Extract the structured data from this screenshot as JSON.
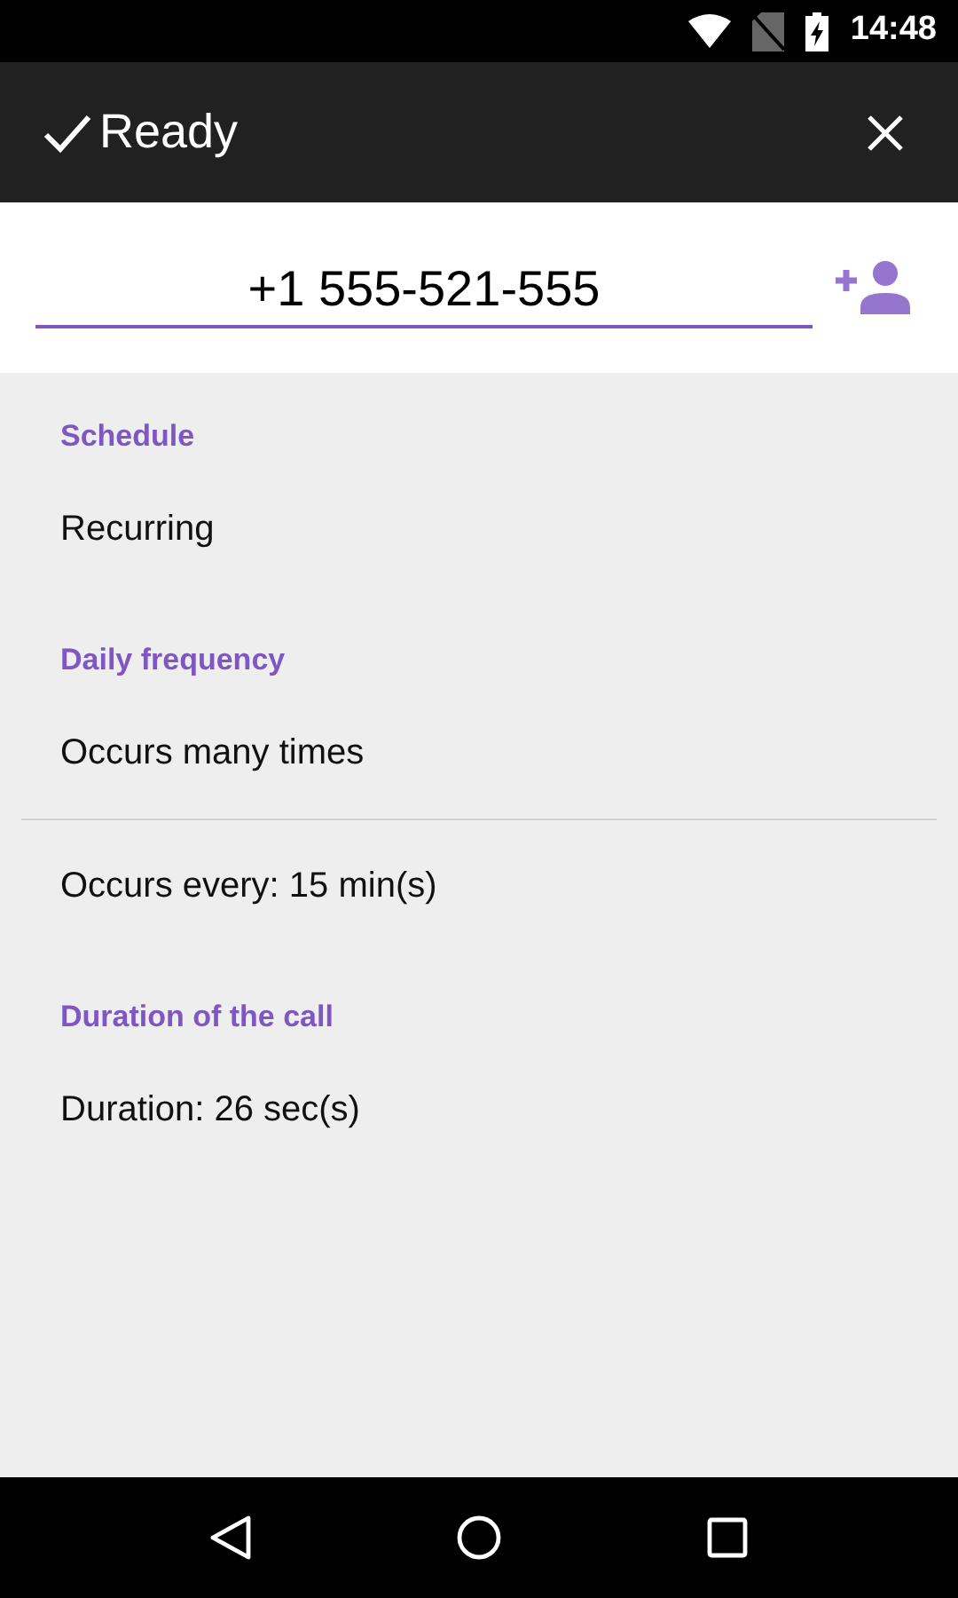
{
  "status_bar": {
    "time": "14:48"
  },
  "app_bar": {
    "title": "Ready"
  },
  "phone_field": {
    "value": "+1 555-521-555"
  },
  "rows": [
    {
      "kind": "header",
      "text": "Schedule"
    },
    {
      "kind": "item",
      "text": "Recurring"
    },
    {
      "kind": "header",
      "text": "Daily frequency"
    },
    {
      "kind": "item",
      "text": "Occurs many times"
    },
    {
      "kind": "divider"
    },
    {
      "kind": "item",
      "text": "Occurs every: 15 min(s)"
    },
    {
      "kind": "header",
      "text": "Duration of the call"
    },
    {
      "kind": "item",
      "text": "Duration: 26 sec(s)"
    }
  ]
}
